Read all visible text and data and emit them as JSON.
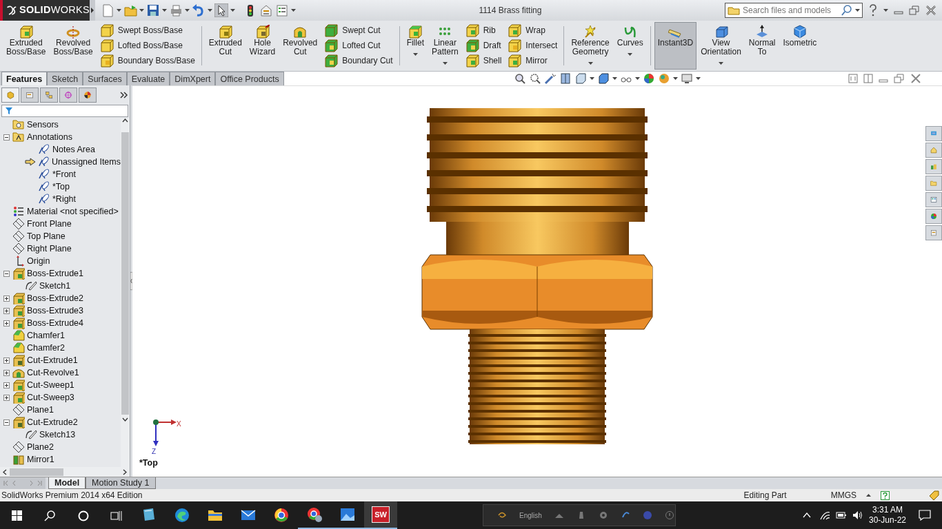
{
  "title_bar": {
    "logo": "**SOLID**WORKS",
    "document_title": "1114 Brass fitting",
    "search": {
      "placeholder": "Search files and models"
    }
  },
  "ribbon": [
    {
      "kind": "large",
      "label": "Extruded\nBoss/Base",
      "has_menu": false,
      "pressed": false
    },
    {
      "kind": "large",
      "label": "Revolved\nBoss/Base",
      "has_menu": false,
      "pressed": false
    },
    {
      "kind": "stack",
      "items": [
        "Swept Boss/Base",
        "Lofted Boss/Base",
        "Boundary Boss/Base"
      ]
    },
    {
      "kind": "separator"
    },
    {
      "kind": "large",
      "label": "Extruded\nCut",
      "has_menu": false,
      "pressed": false
    },
    {
      "kind": "large",
      "label": "Hole\nWizard",
      "has_menu": false,
      "pressed": false
    },
    {
      "kind": "large",
      "label": "Revolved\nCut",
      "has_menu": false,
      "pressed": false
    },
    {
      "kind": "stack",
      "items": [
        "Swept Cut",
        "Lofted Cut",
        "Boundary Cut"
      ]
    },
    {
      "kind": "separator"
    },
    {
      "kind": "large",
      "label": "Fillet",
      "has_menu": true,
      "pressed": false
    },
    {
      "kind": "large",
      "label": "Linear\nPattern",
      "has_menu": true,
      "pressed": false
    },
    {
      "kind": "stack",
      "items": [
        "Rib",
        "Draft",
        "Shell"
      ]
    },
    {
      "kind": "stack",
      "items": [
        "Wrap",
        "Intersect",
        "Mirror"
      ]
    },
    {
      "kind": "separator"
    },
    {
      "kind": "large",
      "label": "Reference\nGeometry",
      "has_menu": true,
      "pressed": false
    },
    {
      "kind": "large",
      "label": "Curves",
      "has_menu": true,
      "pressed": false
    },
    {
      "kind": "separator"
    },
    {
      "kind": "large",
      "label": "Instant3D",
      "has_menu": false,
      "pressed": true
    },
    {
      "kind": "large",
      "label": "View\nOrientation",
      "has_menu": true,
      "pressed": false
    },
    {
      "kind": "large",
      "label": "Normal\nTo",
      "has_menu": false,
      "pressed": false
    },
    {
      "kind": "large",
      "label": "Isometric",
      "has_menu": false,
      "pressed": false
    }
  ],
  "command_tabs": [
    {
      "label": "Features",
      "selected": true
    },
    {
      "label": "Sketch",
      "selected": false
    },
    {
      "label": "Surfaces",
      "selected": false
    },
    {
      "label": "Evaluate",
      "selected": false
    },
    {
      "label": "DimXpert",
      "selected": false
    },
    {
      "label": "Office Products",
      "selected": false
    }
  ],
  "panel_tabs": [
    {
      "selected": true
    },
    {
      "selected": false
    },
    {
      "selected": false
    },
    {
      "selected": false
    },
    {
      "selected": false
    }
  ],
  "feature_tree": [
    {
      "label": "Sensors",
      "kind": "sensor"
    },
    {
      "label": "Annotations",
      "kind": "annotations",
      "expanded": true,
      "children": [
        {
          "label": "Notes Area",
          "kind": "note",
          "pointer": false
        },
        {
          "label": "Unassigned Items",
          "kind": "note",
          "pointer": true
        },
        {
          "label": "*Front",
          "kind": "note",
          "pointer": false
        },
        {
          "label": "*Top",
          "kind": "note",
          "pointer": false
        },
        {
          "label": "*Right",
          "kind": "note",
          "pointer": false
        }
      ]
    },
    {
      "label": "Material <not specified>",
      "kind": "material"
    },
    {
      "label": "Front Plane",
      "kind": "plane"
    },
    {
      "label": "Top Plane",
      "kind": "plane"
    },
    {
      "label": "Right Plane",
      "kind": "plane"
    },
    {
      "label": "Origin",
      "kind": "origin"
    },
    {
      "label": "Boss-Extrude1",
      "kind": "boss",
      "expanded": true,
      "children": [
        {
          "label": "Sketch1",
          "kind": "sketch"
        }
      ]
    },
    {
      "label": "Boss-Extrude2",
      "kind": "boss",
      "expanded": false
    },
    {
      "label": "Boss-Extrude3",
      "kind": "boss",
      "expanded": false
    },
    {
      "label": "Boss-Extrude4",
      "kind": "boss",
      "expanded": false
    },
    {
      "label": "Chamfer1",
      "kind": "chamfer"
    },
    {
      "label": "Chamfer2",
      "kind": "chamfer"
    },
    {
      "label": "Cut-Extrude1",
      "kind": "cut",
      "expanded": false
    },
    {
      "label": "Cut-Revolve1",
      "kind": "revolve",
      "expanded": false
    },
    {
      "label": "Cut-Sweep1",
      "kind": "sweep",
      "expanded": false
    },
    {
      "label": "Cut-Sweep3",
      "kind": "sweep",
      "expanded": false
    },
    {
      "label": "Plane1",
      "kind": "plane"
    },
    {
      "label": "Cut-Extrude2",
      "kind": "cut",
      "expanded": true,
      "children": [
        {
          "label": "Sketch13",
          "kind": "sketch"
        }
      ]
    },
    {
      "label": "Plane2",
      "kind": "plane"
    },
    {
      "label": "Mirror1",
      "kind": "mirror"
    }
  ],
  "viewport": {
    "view_name": "*Top",
    "triad": {
      "x_label": "X",
      "z_label": "Z"
    }
  },
  "bottom_tabs": [
    {
      "label": "Model",
      "selected": true
    },
    {
      "label": "Motion Study 1",
      "selected": false
    }
  ],
  "status_bar": {
    "edition": "SolidWorks Premium 2014 x64 Edition",
    "mode": "Editing Part",
    "units": "MMGS"
  },
  "taskbar": {
    "apps": [
      {
        "running": false
      },
      {
        "running": false
      },
      {
        "running": false
      },
      {
        "running": false
      },
      {
        "running": false
      },
      {
        "running": true
      },
      {
        "running": true
      },
      {
        "running": true,
        "badge": "SW"
      }
    ],
    "language": "English",
    "time": "3:31 AM",
    "date": "30-Jun-22"
  }
}
